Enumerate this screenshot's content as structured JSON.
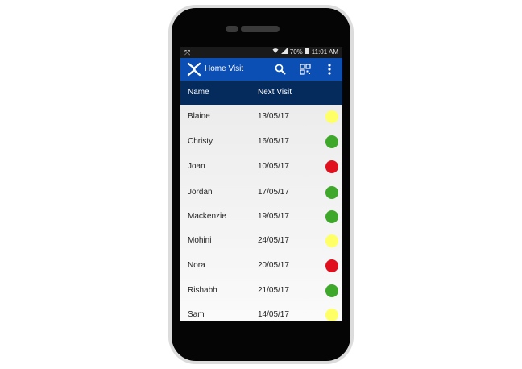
{
  "status_bar": {
    "battery": "70%",
    "time": "11:01 AM"
  },
  "app_bar": {
    "title": "Home Visit",
    "icons": [
      "app-logo-icon",
      "search-icon",
      "qr-code-icon",
      "more-vert-icon"
    ]
  },
  "table": {
    "columns": [
      "Name",
      "Next Visit"
    ],
    "rows": [
      {
        "name": "Blaine",
        "next_visit": "13/05/17",
        "status": "yellow"
      },
      {
        "name": "Christy",
        "next_visit": "16/05/17",
        "status": "green"
      },
      {
        "name": "Joan",
        "next_visit": "10/05/17",
        "status": "red"
      },
      {
        "name": "Jordan",
        "next_visit": "17/05/17",
        "status": "green"
      },
      {
        "name": "Mackenzie",
        "next_visit": "19/05/17",
        "status": "green"
      },
      {
        "name": "Mohini",
        "next_visit": "24/05/17",
        "status": "yellow"
      },
      {
        "name": "Nora",
        "next_visit": "20/05/17",
        "status": "red"
      },
      {
        "name": "Rishabh",
        "next_visit": "21/05/17",
        "status": "green"
      },
      {
        "name": "Sam",
        "next_visit": "14/05/17",
        "status": "yellow"
      }
    ]
  },
  "colors": {
    "app_bar": "#0b4fb4",
    "header": "#052a5c",
    "yellow": "#ffff66",
    "green": "#3ea82a",
    "red": "#e0101e"
  }
}
